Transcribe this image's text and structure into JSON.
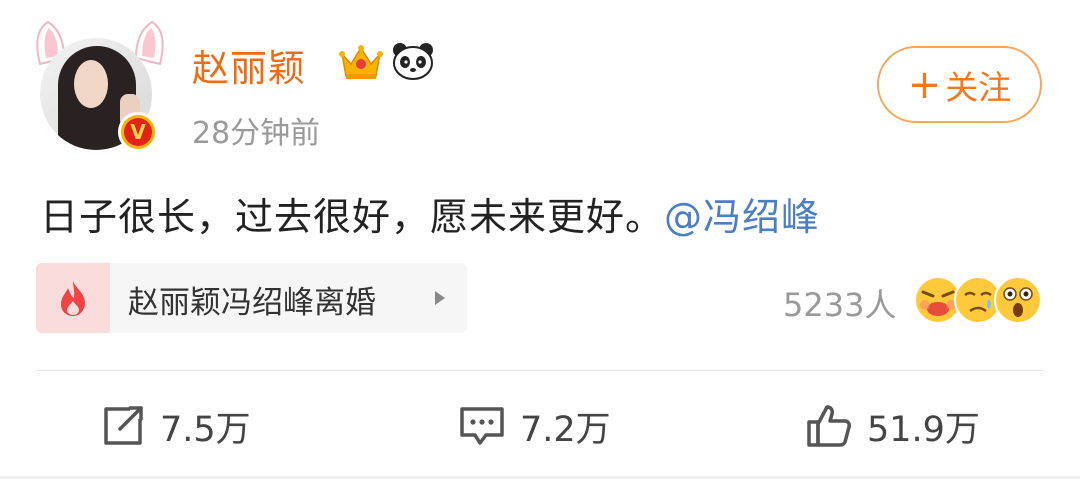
{
  "post": {
    "user": {
      "name": "赵丽颖",
      "time": "28分钟前",
      "verified_badge": "V"
    },
    "follow_button": {
      "plus": "+",
      "label": "关注"
    },
    "content": {
      "text": "日子很长，过去很好，愿未来更好。",
      "mention": "@冯绍峰"
    },
    "topic": {
      "icon": "fire-icon",
      "label": "赵丽颖冯绍峰离婚"
    },
    "reactions": {
      "count": "5233人",
      "emojis": [
        "angry-face-icon",
        "crying-face-icon",
        "surprised-face-icon"
      ]
    },
    "actions": {
      "repost": "7.5万",
      "comment": "7.2万",
      "like": "51.9万"
    }
  },
  "colors": {
    "username": "#ef6b14",
    "mention": "#4b7ec4",
    "follow_border": "#f3a85b",
    "muted": "#9a9a9a"
  }
}
